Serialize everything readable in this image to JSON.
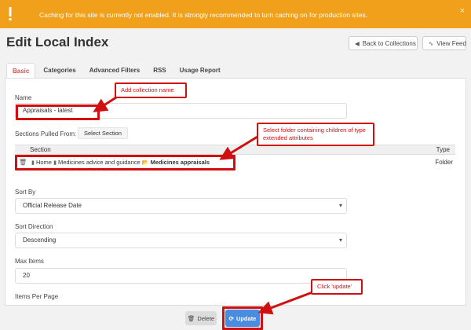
{
  "alert": {
    "message": "Caching for this site is currently not enabled. It is strongly recommended to turn caching on for production sites.",
    "close_glyph": "×",
    "color": "#f0a01a"
  },
  "page": {
    "title": "Edit Local Index",
    "back_label": "Back to Collections",
    "feed_label": "View Feed"
  },
  "tabs": [
    {
      "label": "Basic",
      "active": true
    },
    {
      "label": "Categories"
    },
    {
      "label": "Advanced Filters"
    },
    {
      "label": "RSS"
    },
    {
      "label": "Usage Report"
    }
  ],
  "form": {
    "name_label": "Name",
    "name_value": "Appraisals - latest",
    "sections_label": "Sections Pulled From:",
    "select_section_label": "Select Section",
    "table": {
      "col_section": "Section",
      "col_type": "Type",
      "rows": [
        {
          "path_1": "Home",
          "path_2": "Medicines advice and guidance",
          "path_3": "Medicines appraisals",
          "type": "Folder"
        }
      ]
    },
    "sort_by_label": "Sort By",
    "sort_by_value": "Official Release Date",
    "sort_dir_label": "Sort Direction",
    "sort_dir_value": "Descending",
    "max_items_label": "Max Items",
    "max_items_value": "20",
    "items_per_page_label": "Items Per Page"
  },
  "footer": {
    "delete_label": "Delete",
    "update_label": "Update"
  },
  "annotations": {
    "add_name": "Add collection name",
    "select_folder": "Select folder containing children of type extended attributes",
    "click_update": "Click 'update'",
    "color": "#d01010"
  },
  "icons": [
    "warning-icon",
    "close-icon",
    "back-icon",
    "rss-icon",
    "trash-icon",
    "file-icon",
    "folder-open-icon",
    "update-icon"
  ]
}
